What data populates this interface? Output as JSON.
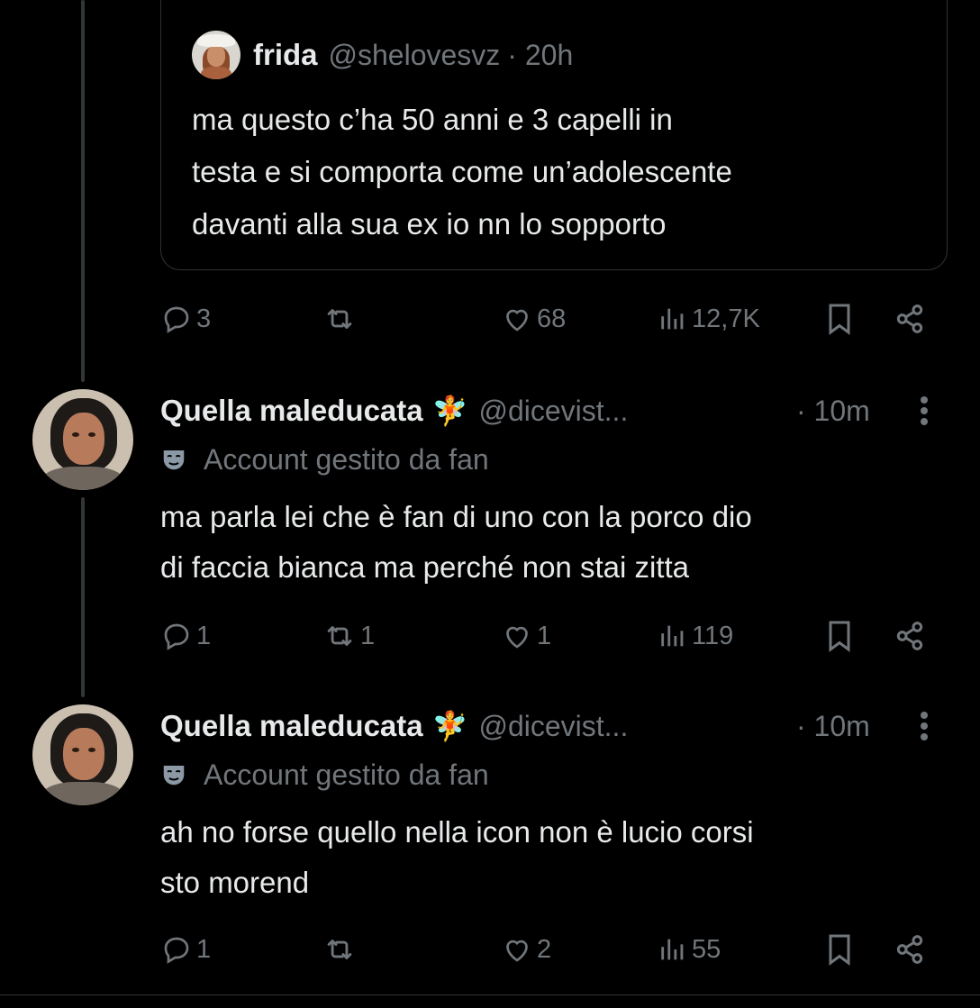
{
  "quoted_post": {
    "name": "frida",
    "handle": "@shelovesvz",
    "time": "· 20h",
    "text": "ma questo c’ha 50 anni e 3 capelli in\ntesta e si comporta come un’adolescente\ndavanti alla sua ex io nn lo sopporto"
  },
  "posts": [
    {
      "actions": {
        "replies": "3",
        "reposts": "",
        "likes": "68",
        "views": "12,7K"
      }
    },
    {
      "name": "Quella maleducata",
      "emoji": "🧚",
      "handle": "@dicevist...",
      "time": "· 10m",
      "label": "Account gestito da fan",
      "text": "ma parla lei che è fan di uno con la porco dio\ndi faccia bianca ma perché non stai zitta",
      "actions": {
        "replies": "1",
        "reposts": "1",
        "likes": "1",
        "views": "119"
      }
    },
    {
      "name": "Quella maleducata",
      "emoji": "🧚",
      "handle": "@dicevist...",
      "time": "· 10m",
      "label": "Account gestito da fan",
      "text": "ah no forse quello nella icon non è lucio corsi\nsto morend",
      "actions": {
        "replies": "1",
        "reposts": "",
        "likes": "2",
        "views": "55"
      }
    }
  ],
  "icons": [
    "reply-icon",
    "repost-icon",
    "like-icon",
    "views-icon",
    "bookmark-icon",
    "share-icon",
    "more-icon",
    "mask-icon"
  ],
  "colors": {
    "background": "#000000",
    "text": "#e7e9ea",
    "muted": "#71767b",
    "border": "#2f3336"
  }
}
